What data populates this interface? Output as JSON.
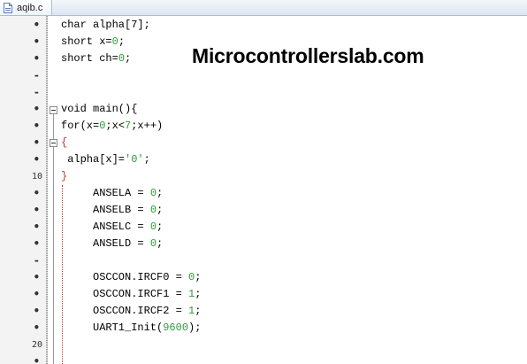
{
  "tab": {
    "filename": "aqib.c",
    "icon": "c-file-icon"
  },
  "watermark": "Microcontrollerslab.com",
  "colors": {
    "number": "#2f9a3a",
    "brace": "#c0392b",
    "text": "#000000"
  },
  "gutter": [
    {
      "mark": "•"
    },
    {
      "mark": "•"
    },
    {
      "mark": "•"
    },
    {
      "mark": "-"
    },
    {
      "mark": "-"
    },
    {
      "mark": "•"
    },
    {
      "mark": "•"
    },
    {
      "mark": "•"
    },
    {
      "mark": "•"
    },
    {
      "mark": "10"
    },
    {
      "mark": "•"
    },
    {
      "mark": "•"
    },
    {
      "mark": "•"
    },
    {
      "mark": "•"
    },
    {
      "mark": "-"
    },
    {
      "mark": "•"
    },
    {
      "mark": "•"
    },
    {
      "mark": "•"
    },
    {
      "mark": "•"
    },
    {
      "mark": "20"
    },
    {
      "mark": "•"
    }
  ],
  "code_lines": [
    [
      {
        "t": "char alpha[7];"
      }
    ],
    [
      {
        "t": "short x="
      },
      {
        "t": "0",
        "k": "num"
      },
      {
        "t": ";"
      }
    ],
    [
      {
        "t": "short ch="
      },
      {
        "t": "0",
        "k": "num"
      },
      {
        "t": ";"
      }
    ],
    [],
    [],
    [
      {
        "t": "void main(){"
      }
    ],
    [
      {
        "t": "for(x="
      },
      {
        "t": "0",
        "k": "num"
      },
      {
        "t": ";x<"
      },
      {
        "t": "7",
        "k": "num"
      },
      {
        "t": ";x++)"
      }
    ],
    [
      {
        "t": "{",
        "k": "brace"
      }
    ],
    [
      {
        "t": " alpha[x]="
      },
      {
        "t": "'0'",
        "k": "str"
      },
      {
        "t": ";"
      }
    ],
    [
      {
        "t": "}",
        "k": "brace"
      }
    ],
    [
      {
        "t": "     ANSELA = "
      },
      {
        "t": "0",
        "k": "num"
      },
      {
        "t": ";"
      }
    ],
    [
      {
        "t": "     ANSELB = "
      },
      {
        "t": "0",
        "k": "num"
      },
      {
        "t": ";"
      }
    ],
    [
      {
        "t": "     ANSELC = "
      },
      {
        "t": "0",
        "k": "num"
      },
      {
        "t": ";"
      }
    ],
    [
      {
        "t": "     ANSELD = "
      },
      {
        "t": "0",
        "k": "num"
      },
      {
        "t": ";"
      }
    ],
    [],
    [
      {
        "t": "     OSCCON.IRCF0 = "
      },
      {
        "t": "0",
        "k": "num"
      },
      {
        "t": ";"
      }
    ],
    [
      {
        "t": "     OSCCON.IRCF1 = "
      },
      {
        "t": "1",
        "k": "num"
      },
      {
        "t": ";"
      }
    ],
    [
      {
        "t": "     OSCCON.IRCF2 = "
      },
      {
        "t": "1",
        "k": "num"
      },
      {
        "t": ";"
      }
    ],
    [
      {
        "t": "     UART1_Init("
      },
      {
        "t": "9600",
        "k": "num"
      },
      {
        "t": ");"
      }
    ],
    [],
    []
  ]
}
